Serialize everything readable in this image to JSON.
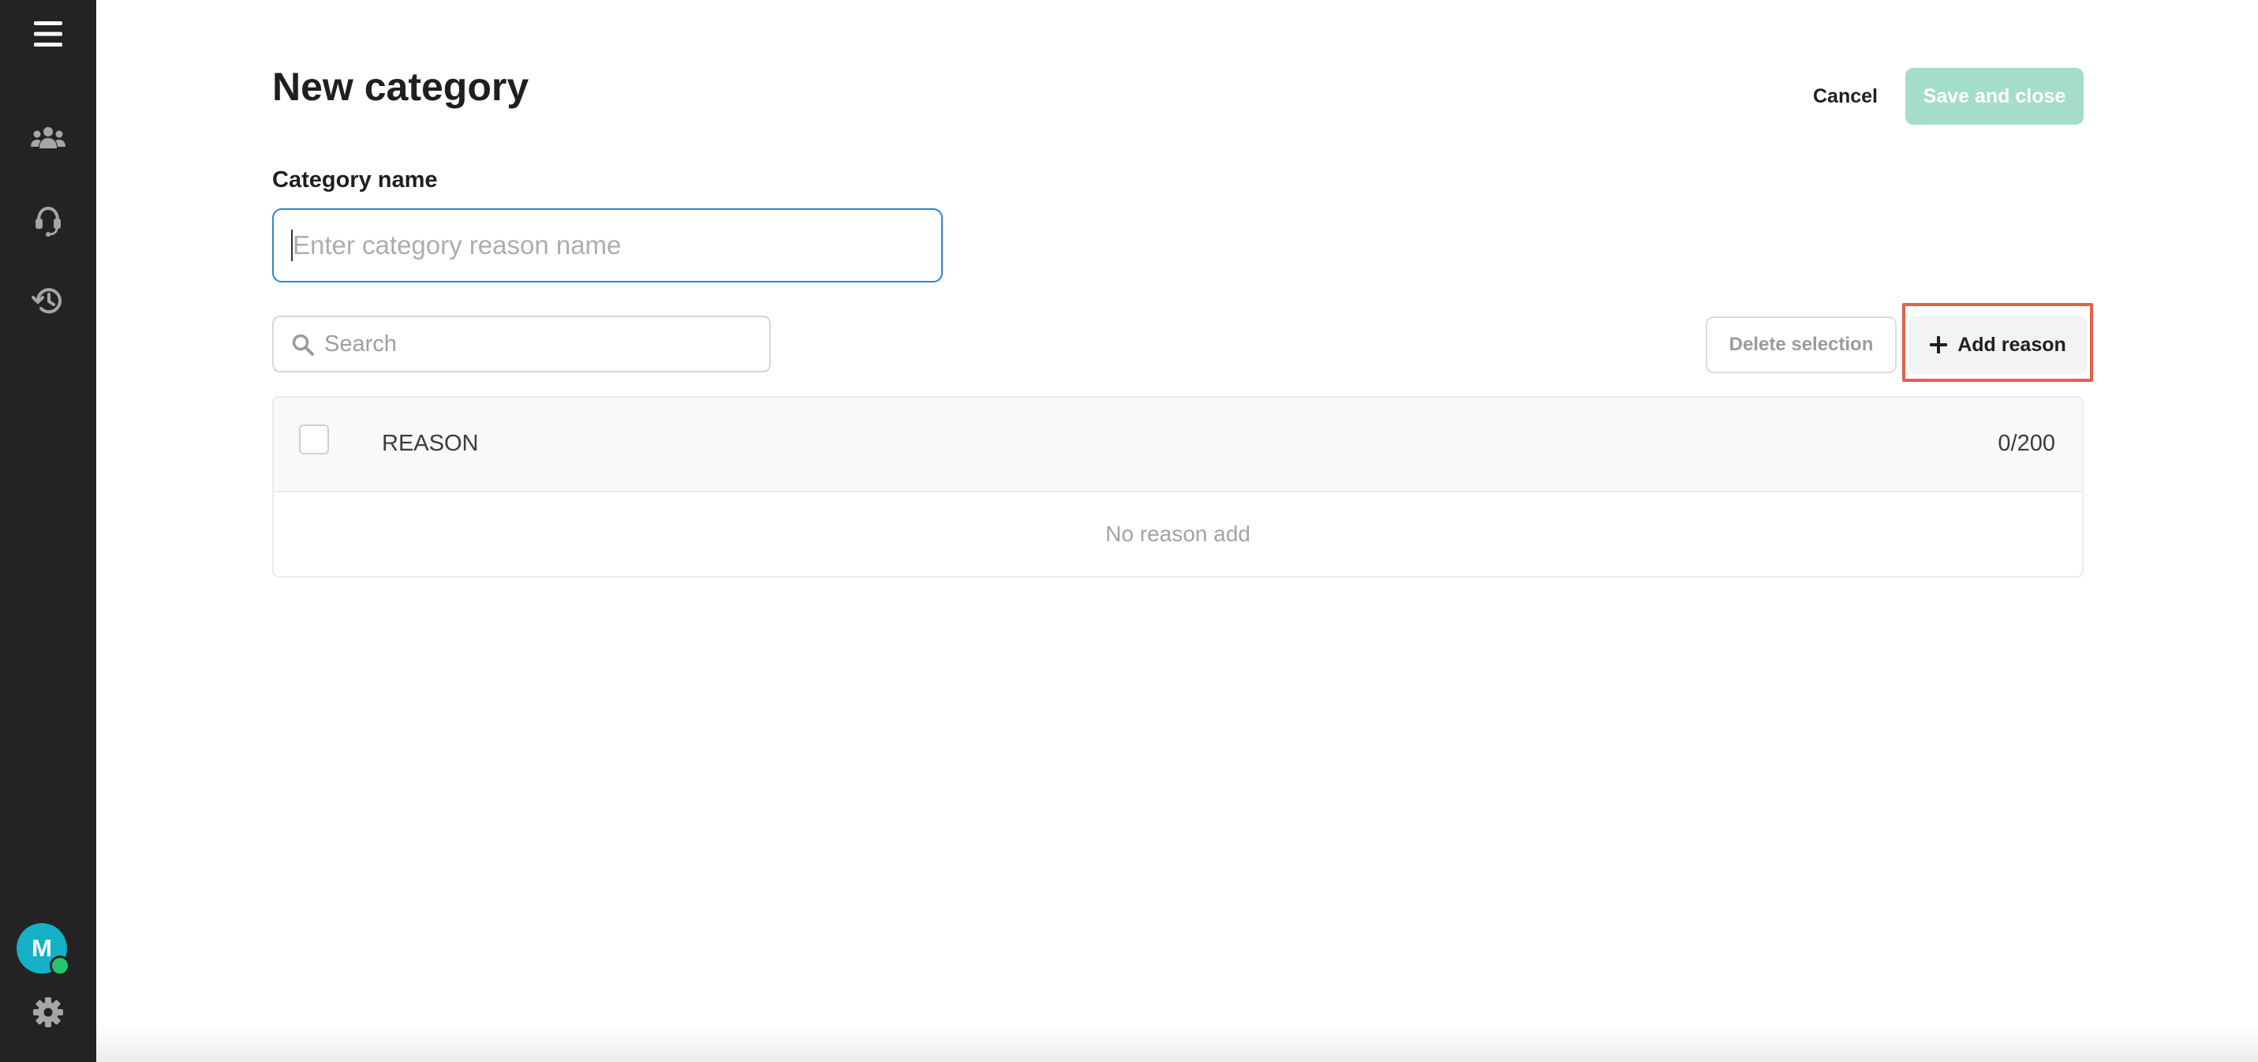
{
  "sidebar": {
    "menu_icon": "hamburger-menu-icon",
    "items": [
      {
        "icon": "team-icon"
      },
      {
        "icon": "headset-icon"
      },
      {
        "icon": "history-icon"
      }
    ],
    "avatar_initial": "M",
    "settings_icon": "gear-icon"
  },
  "header": {
    "title": "New category",
    "cancel_label": "Cancel",
    "save_label": "Save and close"
  },
  "form": {
    "category_label": "Category name",
    "category_placeholder": "Enter category reason name",
    "category_value": ""
  },
  "toolbar": {
    "search_placeholder": "Search",
    "delete_label": "Delete selection",
    "add_label": "Add reason"
  },
  "table": {
    "column_reason": "REASON",
    "count": "0/200",
    "empty_text": "No reason add",
    "rows": []
  },
  "colors": {
    "sidebar_bg": "#232323",
    "accent_disabled": "#a5dec8",
    "input_focus": "#2f86c5",
    "highlight": "#e5604c",
    "avatar": "#14b0c6",
    "status_online": "#27c46b"
  }
}
